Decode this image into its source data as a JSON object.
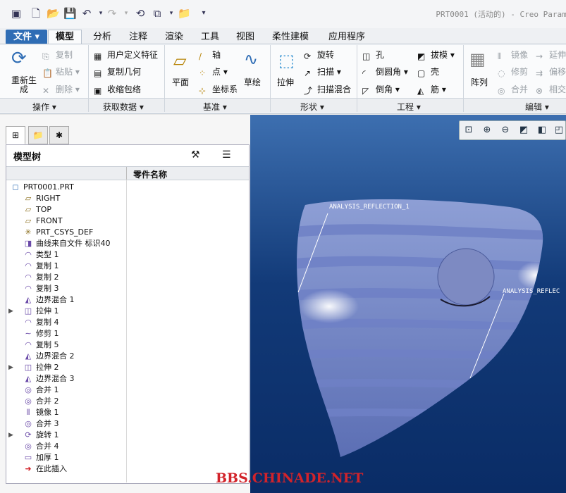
{
  "window": {
    "title": "PRT0001 (活动的) - Creo Paramet"
  },
  "menu_tabs": [
    "文件 ▾",
    "模型",
    "分析",
    "注释",
    "渲染",
    "工具",
    "视图",
    "柔性建模",
    "应用程序"
  ],
  "ribbon": {
    "operations": {
      "regen": "重新生成",
      "copy": "复制",
      "paste": "粘贴",
      "delete": "删除",
      "group": "操作 ▾"
    },
    "getdata": {
      "udf": "用户定义特征",
      "copygeom": "复制几何",
      "shrink": "收缩包络",
      "group": "获取数据 ▾"
    },
    "datum": {
      "plane": "平面",
      "axis": "轴",
      "point": "点",
      "csys": "坐标系",
      "sketch": "草绘",
      "group": "基准 ▾"
    },
    "shapes": {
      "extrude": "拉伸",
      "revolve": "旋转",
      "sweep": "扫描",
      "swept_blend": "扫描混合",
      "group": "形状 ▾"
    },
    "engineering": {
      "hole": "孔",
      "round": "倒圆角",
      "chamfer": "倒角",
      "draft": "拔模",
      "shell": "壳",
      "rib": "筋",
      "group": "工程 ▾"
    },
    "editing": {
      "pattern": "阵列",
      "mirror": "镜像",
      "trim": "修剪",
      "merge": "合并",
      "extend": "延伸",
      "offset": "偏移",
      "intersect": "相交",
      "group": "编辑 ▾"
    }
  },
  "tree": {
    "title": "模型树",
    "column": "零件名称",
    "items": [
      {
        "label": "PRT0001.PRT",
        "icon": "part-icon",
        "expand": false
      },
      {
        "label": "RIGHT",
        "icon": "datum-plane-icon",
        "expand": false
      },
      {
        "label": "TOP",
        "icon": "datum-plane-icon",
        "expand": false
      },
      {
        "label": "FRONT",
        "icon": "datum-plane-icon",
        "expand": false
      },
      {
        "label": "PRT_CSYS_DEF",
        "icon": "csys-icon",
        "expand": false
      },
      {
        "label": "曲线来自文件 标识40",
        "icon": "curve-file-icon",
        "expand": false
      },
      {
        "label": "类型 1",
        "icon": "surface-icon",
        "expand": false
      },
      {
        "label": "复制 1",
        "icon": "surface-icon",
        "expand": false
      },
      {
        "label": "复制 2",
        "icon": "surface-icon",
        "expand": false
      },
      {
        "label": "复制 3",
        "icon": "surface-icon",
        "expand": false
      },
      {
        "label": "边界混合 1",
        "icon": "boundary-blend-icon",
        "expand": false
      },
      {
        "label": "拉伸 1",
        "icon": "extrude-icon",
        "expand": true
      },
      {
        "label": "复制 4",
        "icon": "surface-icon",
        "expand": false
      },
      {
        "label": "修剪 1",
        "icon": "trim-icon",
        "expand": false
      },
      {
        "label": "复制 5",
        "icon": "surface-icon",
        "expand": false
      },
      {
        "label": "边界混合 2",
        "icon": "boundary-blend-icon",
        "expand": false
      },
      {
        "label": "拉伸 2",
        "icon": "extrude-icon",
        "expand": true
      },
      {
        "label": "边界混合 3",
        "icon": "boundary-blend-icon",
        "expand": false
      },
      {
        "label": "合并 1",
        "icon": "merge-icon",
        "expand": false
      },
      {
        "label": "合并 2",
        "icon": "merge-icon",
        "expand": false
      },
      {
        "label": "镜像 1",
        "icon": "mirror-icon",
        "expand": false
      },
      {
        "label": "合并 3",
        "icon": "merge-icon",
        "expand": false
      },
      {
        "label": "旋转 1",
        "icon": "revolve-icon",
        "expand": true
      },
      {
        "label": "合并 4",
        "icon": "merge-icon",
        "expand": false
      },
      {
        "label": "加厚 1",
        "icon": "thicken-icon",
        "expand": false
      },
      {
        "label": "在此插入",
        "icon": "insert-here-icon",
        "expand": false
      }
    ]
  },
  "viewport": {
    "annotations": [
      "ANALYSIS_REFLECTION_1",
      "ANALYSIS_REFLEC"
    ]
  },
  "watermark": "BBS.CHINADE.NET"
}
